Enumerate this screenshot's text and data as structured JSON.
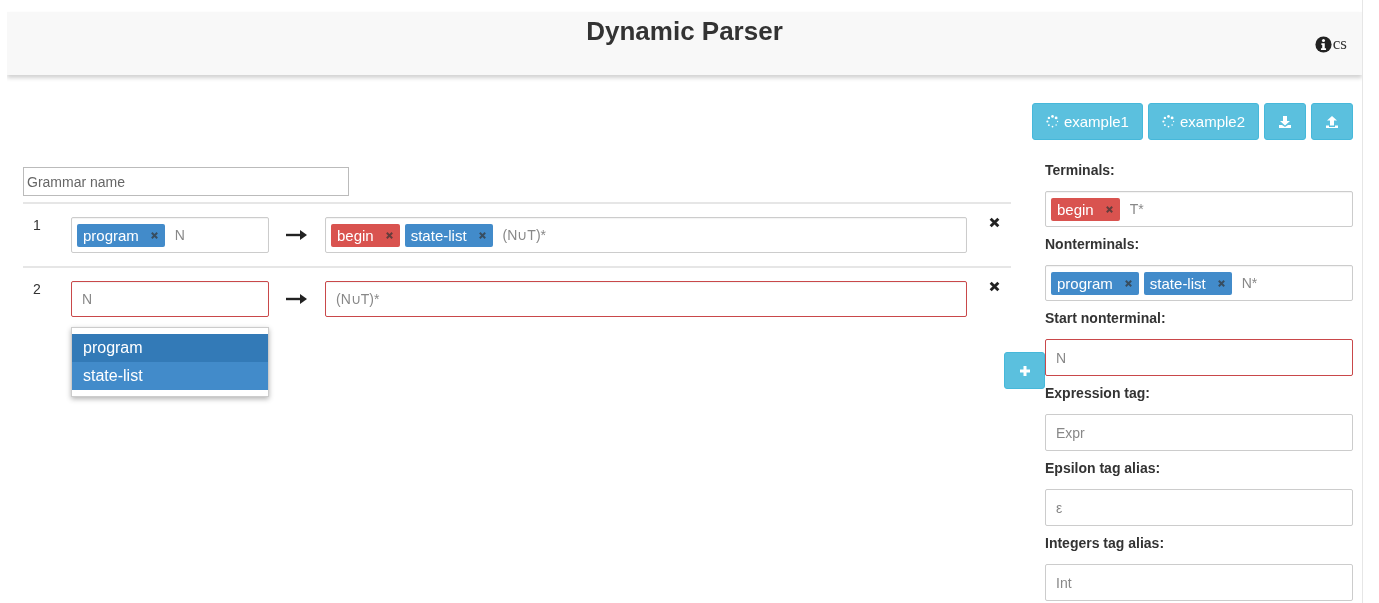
{
  "header": {
    "title": "Dynamic Parser",
    "info_text": "cs"
  },
  "toolbar": [
    {
      "kind": "example",
      "label": "example1"
    },
    {
      "kind": "example",
      "label": "example2"
    },
    {
      "kind": "download"
    },
    {
      "kind": "upload"
    }
  ],
  "grammar_name": {
    "placeholder": "Grammar name"
  },
  "rules": [
    {
      "number": "1",
      "lhs": {
        "tags": [
          {
            "label": "program",
            "kind": "nonterminal"
          }
        ],
        "placeholder": "N",
        "invalid": false
      },
      "rhs": {
        "tags": [
          {
            "label": "begin",
            "kind": "terminal"
          },
          {
            "label": "state-list",
            "kind": "nonterminal"
          }
        ],
        "placeholder": "(N∪T)*",
        "invalid": false
      }
    },
    {
      "number": "2",
      "lhs": {
        "placeholder": "N",
        "invalid": true
      },
      "rhs": {
        "placeholder": "(N∪T)*",
        "invalid": true
      },
      "suggestions": [
        {
          "label": "program",
          "selected": true
        },
        {
          "label": "state-list",
          "selected": false
        }
      ]
    }
  ],
  "settings": [
    {
      "label": "Terminals:",
      "tags": [
        {
          "label": "begin",
          "kind": "terminal"
        }
      ],
      "placeholder": "T*",
      "invalid": false
    },
    {
      "label": "Nonterminals:",
      "tags": [
        {
          "label": "program",
          "kind": "nonterminal"
        },
        {
          "label": "state-list",
          "kind": "nonterminal"
        }
      ],
      "placeholder": "N*",
      "invalid": false
    },
    {
      "label": "Start nonterminal:",
      "placeholder": "N",
      "invalid": true
    },
    {
      "label": "Expression tag:",
      "placeholder": "Expr",
      "invalid": false
    },
    {
      "label": "Epsilon tag alias:",
      "placeholder": "ε",
      "invalid": false
    },
    {
      "label": "Integers tag alias:",
      "placeholder": "Int",
      "invalid": false
    }
  ]
}
